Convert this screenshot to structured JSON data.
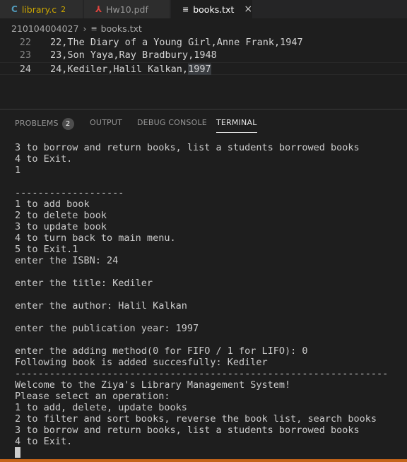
{
  "tabs": [
    {
      "icon": "C",
      "label": "library.c",
      "count": "2"
    },
    {
      "icon": "pdf",
      "label": "Hw10.pdf"
    },
    {
      "icon": "txt",
      "label": "books.txt",
      "close": "×"
    }
  ],
  "breadcrumb": {
    "folder": "210104004027",
    "separator": "›",
    "file": "books.txt"
  },
  "editor": {
    "lines": [
      {
        "num": "22",
        "text": "22,The Diary of a Young Girl,Anne Frank,1947"
      },
      {
        "num": "23",
        "text": "23,Son Yaya,Ray Bradbury,1948"
      },
      {
        "num": "24",
        "text_before": "24,Kediler,Halil Kalkan,",
        "text_selected": "1997"
      }
    ]
  },
  "panel": {
    "tabs": [
      {
        "label": "PROBLEMS",
        "badge": "2"
      },
      {
        "label": "OUTPUT"
      },
      {
        "label": "DEBUG CONSOLE"
      },
      {
        "label": "TERMINAL"
      }
    ]
  },
  "terminal": {
    "lines": [
      "3 to borrow and return books, list a students borrowed books",
      "4 to Exit.",
      "1",
      "",
      "-------------------",
      "1 to add book",
      "2 to delete book",
      "3 to update book",
      "4 to turn back to main menu.",
      "5 to Exit.1",
      "enter the ISBN: 24",
      "",
      "enter the title: Kediler",
      "",
      "enter the author: Halil Kalkan",
      "",
      "enter the publication year: 1997",
      "",
      "enter the adding method(0 for FIFO / 1 for LIFO): 0",
      "Following book is added succesfully: Kediler",
      "-----------------------------------------------------------------",
      "Welcome to the Ziya's Library Management System!",
      "Please select an operation:",
      "1 to add, delete, update books",
      "2 to filter and sort books, reverse the book list, search books",
      "3 to borrow and return books, list a students borrowed books",
      "4 to Exit."
    ]
  },
  "colors": {
    "accent": "#c5651a",
    "warning": "#cca700",
    "pdf": "#e0443e",
    "c_icon": "#519aba"
  }
}
